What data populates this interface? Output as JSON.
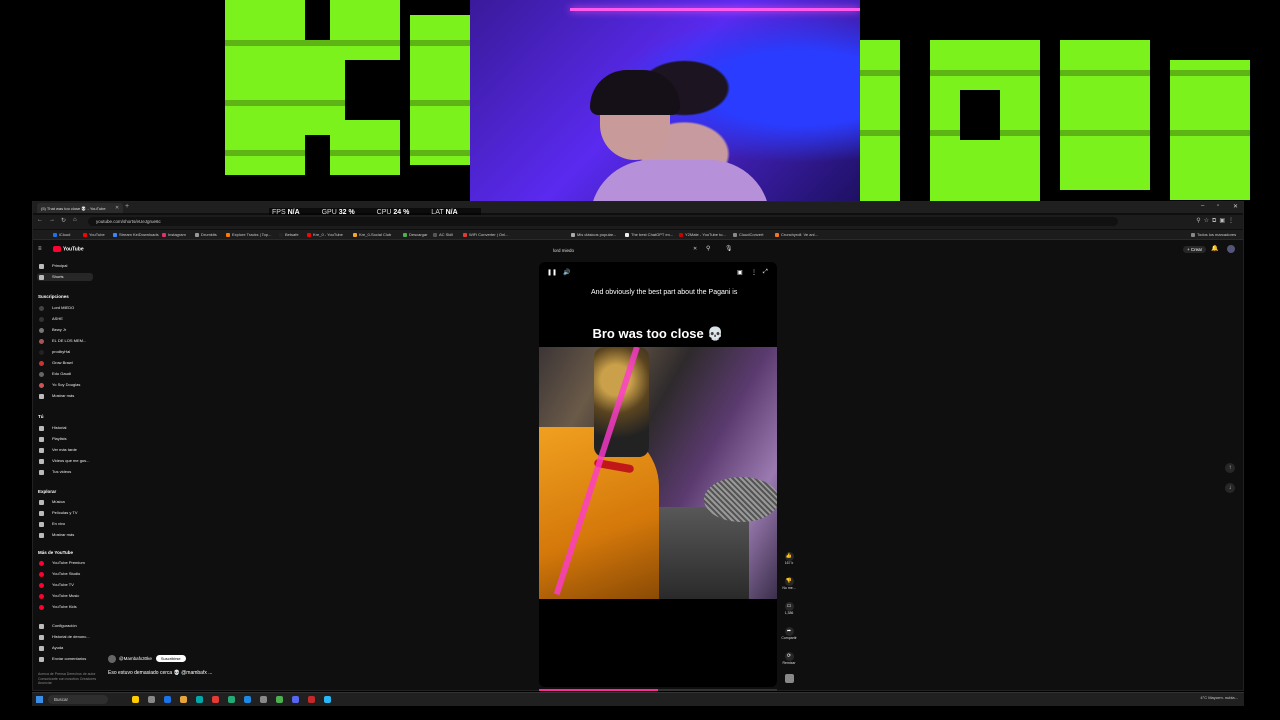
{
  "overlay": {
    "perf": [
      {
        "label": "FPS",
        "value": "N/A"
      },
      {
        "label": "GPU",
        "value": "32 %"
      },
      {
        "label": "CPU",
        "value": "24 %"
      },
      {
        "label": "LAT",
        "value": "N/A"
      }
    ],
    "brand_green": "#7cf21c"
  },
  "browser": {
    "tab_title": "(5) That was too close 💀 - YouTube",
    "url": "youtube.com/shorts/eUeJgrue6c",
    "bookmarks": [
      "iCloud",
      "YouTube",
      "Stream KeiDownloads",
      "Instagram",
      "Drumkits",
      "Explore Tracks | Top...",
      "Betsafe",
      "Kre_0 - YouTube",
      "Kre_0-Social Club",
      "Descargar",
      "AC Skill",
      "WiFi Converter | Onl...",
      "Mis clásicos popular...",
      "The best ChatGPT en...",
      "Y2Mate - YouTube to...",
      "CloudConvert",
      "Crunchyroll: Ve ani..."
    ],
    "all_bookmarks": "Todos los marcadores"
  },
  "youtube": {
    "logo": "YouTube",
    "search_value": "lord miedo",
    "create_label": "Crear",
    "sidebar": {
      "main": [
        "Principal",
        "Shorts"
      ],
      "subs_heading": "Suscripciones",
      "subs": [
        "Lord MIEDO",
        "ASHE",
        "Bewy Jr",
        "EL DE LOS MEM...",
        "prodbyHal",
        "Grow Brawl",
        "Edu Gaudi",
        "Yo Soy Douglas"
      ],
      "show_more": "Mostrar más",
      "you_heading": "Tú",
      "you": [
        "Historial",
        "Playlists",
        "Ver más tarde",
        "Videos que me gus...",
        "Tus videos"
      ],
      "explore_heading": "Explorar",
      "explore": [
        "Música",
        "Películas y TV",
        "En vivo"
      ],
      "show_more_2": "Mostrar más",
      "more_heading": "Más de YouTube",
      "more": [
        "YouTube Premium",
        "YouTube Studio",
        "YouTube TV",
        "YouTube Music",
        "YouTube Kids"
      ],
      "settings": [
        "Configuración",
        "Historial de denunc...",
        "Ayuda",
        "Enviar comentarios"
      ],
      "footer": "Acerca de  Prensa  Derechos de autor  Comunicarte con nosotros  Creadores  Anunciar"
    },
    "short": {
      "caption": "And obviously the best part about the Pagani is",
      "overlay_title": "Bro was too close 💀",
      "likes": "167 k",
      "dislike_label": "No me...",
      "comments": "1,386",
      "share": "Compartir",
      "remix": "Remixar",
      "channel": "@Mambafx30ke",
      "subscribe": "Suscribirse",
      "description": "Eso estuvo demasiado cerca 💀 @mambafx ...",
      "progress": 0.5
    }
  },
  "taskbar": {
    "search_placeholder": "Buscar",
    "tray": "4°C Mayorm. nubla..."
  }
}
